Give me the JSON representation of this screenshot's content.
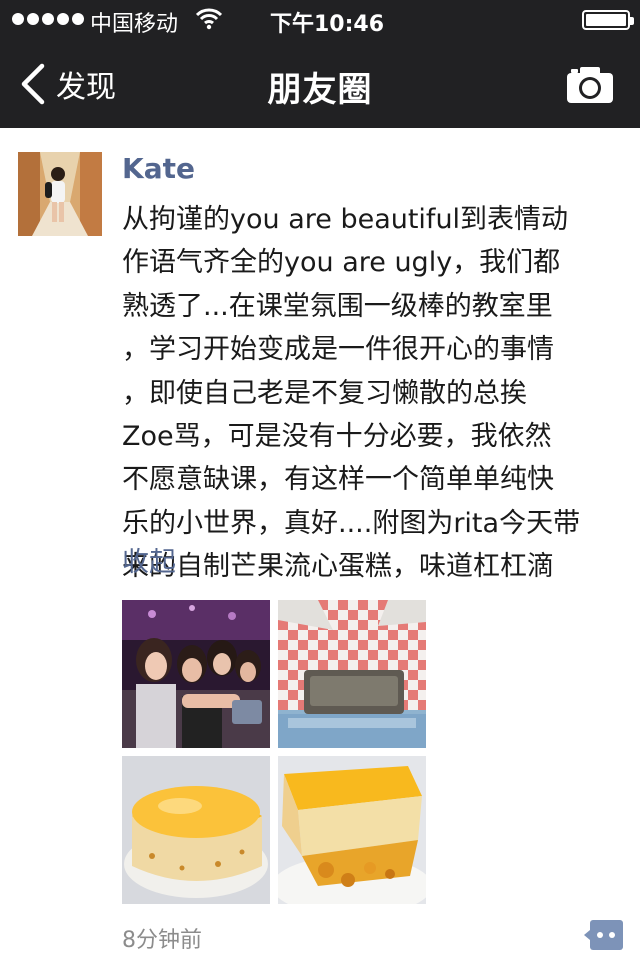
{
  "status_bar": {
    "carrier": "中国移动",
    "time": "下午10:46"
  },
  "nav": {
    "back_label": "发现",
    "title": "朋友圈",
    "back_icon": "chevron-left-icon",
    "camera_icon": "camera-icon"
  },
  "post": {
    "author": "Kate",
    "text_lines": [
      "从拘谨的you are beautiful到表情动",
      "作语气齐全的you are ugly，我们都",
      "熟透了...在课堂氛围一级棒的教室里",
      "，学习开始变成是一件很开心的事情",
      "，即使自己老是不复习懒散的总挨",
      "Zoe骂，可是没有十分必要，我依然",
      "不愿意缺课，有这样一个简单单纯快",
      "乐的小世界，真好....附图为rita今天带",
      "来的自制芒果流心蛋糕，味道杠杠滴"
    ],
    "collapse_label": "收起",
    "timestamp": "8分钟前",
    "comment_icon": "comment-bubble-icon"
  },
  "colors": {
    "topbar_bg": "#212123",
    "name_link": "#53668f",
    "timestamp": "#8c8c8c",
    "comment_icon": "#7d93b8"
  }
}
